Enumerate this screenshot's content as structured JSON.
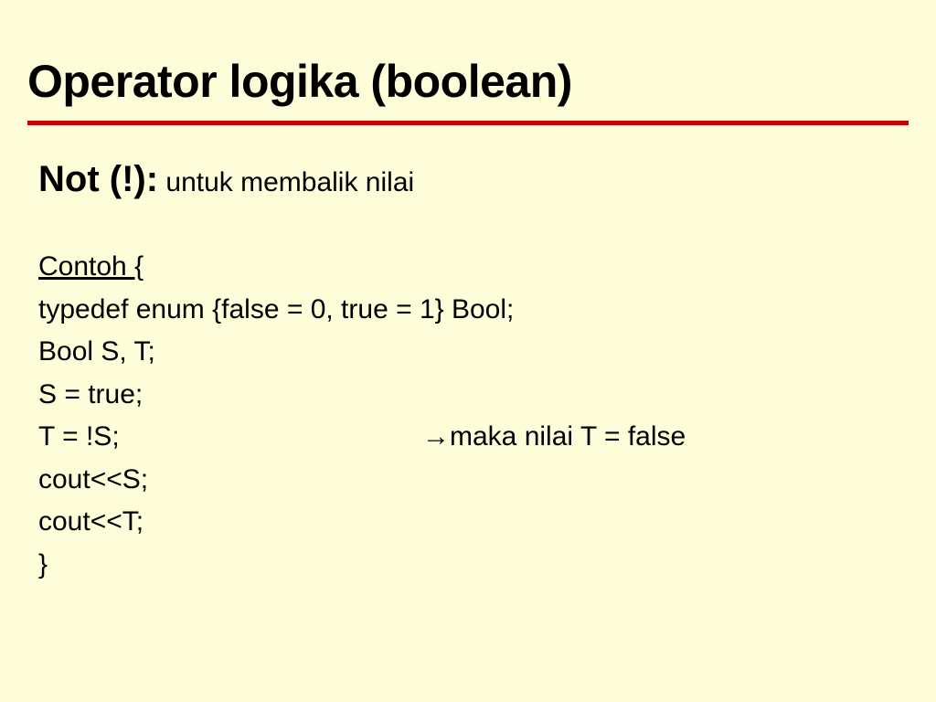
{
  "title": "Operator logika (boolean)",
  "subhead_strong": "Not (!):",
  "subhead_rest": " untuk membalik nilai",
  "contoh_label": "Contoh {",
  "code": {
    "line1": "typedef enum {false = 0, true = 1} Bool;",
    "line2": "Bool S, T;",
    "line3": "S = true;",
    "line4_left": "T = !S;",
    "line4_right_arrow": "→",
    "line4_right_text": "maka nilai T = false",
    "line5": "cout<<S;",
    "line6": "cout<<T;",
    "line7": "}"
  }
}
